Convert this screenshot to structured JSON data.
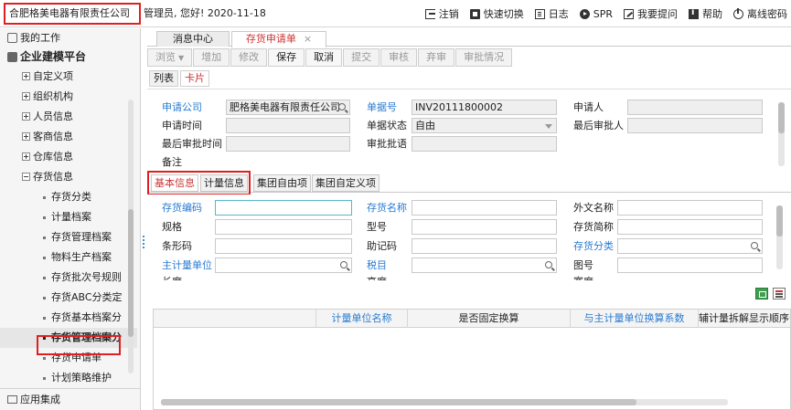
{
  "topbar": {
    "company": "合肥格美电器有限责任公司",
    "greeting": "管理员, 您好! 2020-11-18",
    "actions": [
      {
        "icon": "logout-icon",
        "label": "注销"
      },
      {
        "icon": "switch-icon",
        "label": "快速切换"
      },
      {
        "icon": "log-icon",
        "label": "日志"
      },
      {
        "icon": "spr-icon",
        "label": "SPR"
      },
      {
        "icon": "ask-icon",
        "label": "我要提问"
      },
      {
        "icon": "help-icon",
        "label": "帮助"
      },
      {
        "icon": "offline-icon",
        "label": "离线密码"
      }
    ]
  },
  "sidebar": {
    "my_work": "我的工作",
    "platform": "企业建模平台",
    "app_integration": "应用集成",
    "items": [
      {
        "label": "自定义项",
        "level": 1,
        "state": "closed"
      },
      {
        "label": "组织机构",
        "level": 1,
        "state": "closed"
      },
      {
        "label": "人员信息",
        "level": 1,
        "state": "closed"
      },
      {
        "label": "客商信息",
        "level": 1,
        "state": "closed"
      },
      {
        "label": "仓库信息",
        "level": 1,
        "state": "closed"
      },
      {
        "label": "存货信息",
        "level": 1,
        "state": "open"
      },
      {
        "label": "存货分类",
        "level": 2
      },
      {
        "label": "计量档案",
        "level": 2
      },
      {
        "label": "存货管理档案",
        "level": 2
      },
      {
        "label": "物料生产档案",
        "level": 2
      },
      {
        "label": "存货批次号规则",
        "level": 2
      },
      {
        "label": "存货ABC分类定",
        "level": 2
      },
      {
        "label": "存货基本档案分",
        "level": 2
      },
      {
        "label": "存货管理档案分",
        "level": 2,
        "active": true
      },
      {
        "label": "存货申请单",
        "level": 2
      },
      {
        "label": "计划策略维护",
        "level": 2
      }
    ]
  },
  "tabs": {
    "message_center": "消息中心",
    "inventory_request": "存货申请单",
    "close": "×"
  },
  "toolbar": {
    "browse": "浏览",
    "add": "增加",
    "modify": "修改",
    "save": "保存",
    "cancel": "取消",
    "submit": "提交",
    "review": "审核",
    "abandon": "弃审",
    "approval_status": "审批情况"
  },
  "view_tabs": {
    "list": "列表",
    "card": "卡片"
  },
  "header_form": {
    "apply_company_label": "申请公司",
    "apply_company_value": "肥格美电器有限责任公司",
    "doc_no_label": "单据号",
    "doc_no_value": "INV20111800002",
    "applicant_label": "申请人",
    "apply_time_label": "申请时间",
    "doc_status_label": "单据状态",
    "doc_status_value": "自由",
    "last_approver_label": "最后审批人",
    "last_approve_time_label": "最后审批时间",
    "approve_comment_label": "审批批语",
    "remark_label": "备注"
  },
  "sub_tabs": {
    "basic": "基本信息",
    "measure": "计量信息",
    "group_free": "集团自由项",
    "group_custom": "集团自定义项"
  },
  "detail_form": {
    "inv_code": "存货编码",
    "inv_name": "存货名称",
    "foreign_name": "外文名称",
    "spec": "规格",
    "model": "型号",
    "inv_short_name": "存货简称",
    "barcode": "条形码",
    "mnemonic": "助记码",
    "inv_class": "存货分类",
    "main_unit": "主计量单位",
    "tax_item": "税目",
    "drawing_no": "图号",
    "length": "长度",
    "height": "高度",
    "width": "宽度"
  },
  "grid": {
    "columns": [
      "计量单位名称",
      "是否固定换算",
      "与主计量单位换算系数",
      "辅计量拆解显示顺序号"
    ]
  },
  "colors": {
    "highlight_red": "#e02020",
    "label_blue": "#2a7bd0",
    "active_tab_text": "#cc3333"
  }
}
